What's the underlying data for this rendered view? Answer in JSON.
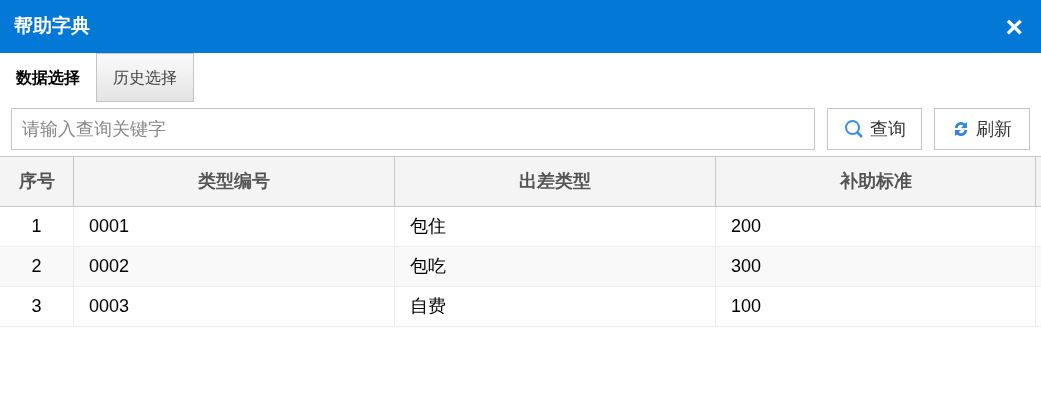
{
  "window": {
    "title": "帮助字典",
    "close": "×"
  },
  "tabs": [
    {
      "label": "数据选择",
      "selected": true
    },
    {
      "label": "历史选择",
      "selected": false
    }
  ],
  "search": {
    "placeholder": "请输入查询关键字"
  },
  "buttons": [
    {
      "kind": "search",
      "label": "查询"
    },
    {
      "kind": "refresh",
      "label": "刷新"
    }
  ],
  "table": {
    "columns": [
      "序号",
      "类型编号",
      "出差类型",
      "补助标准"
    ],
    "rows": [
      [
        "1",
        "0001",
        "包住",
        "200"
      ],
      [
        "2",
        "0002",
        "包吃",
        "300"
      ],
      [
        "3",
        "0003",
        "自费",
        "100"
      ]
    ]
  }
}
